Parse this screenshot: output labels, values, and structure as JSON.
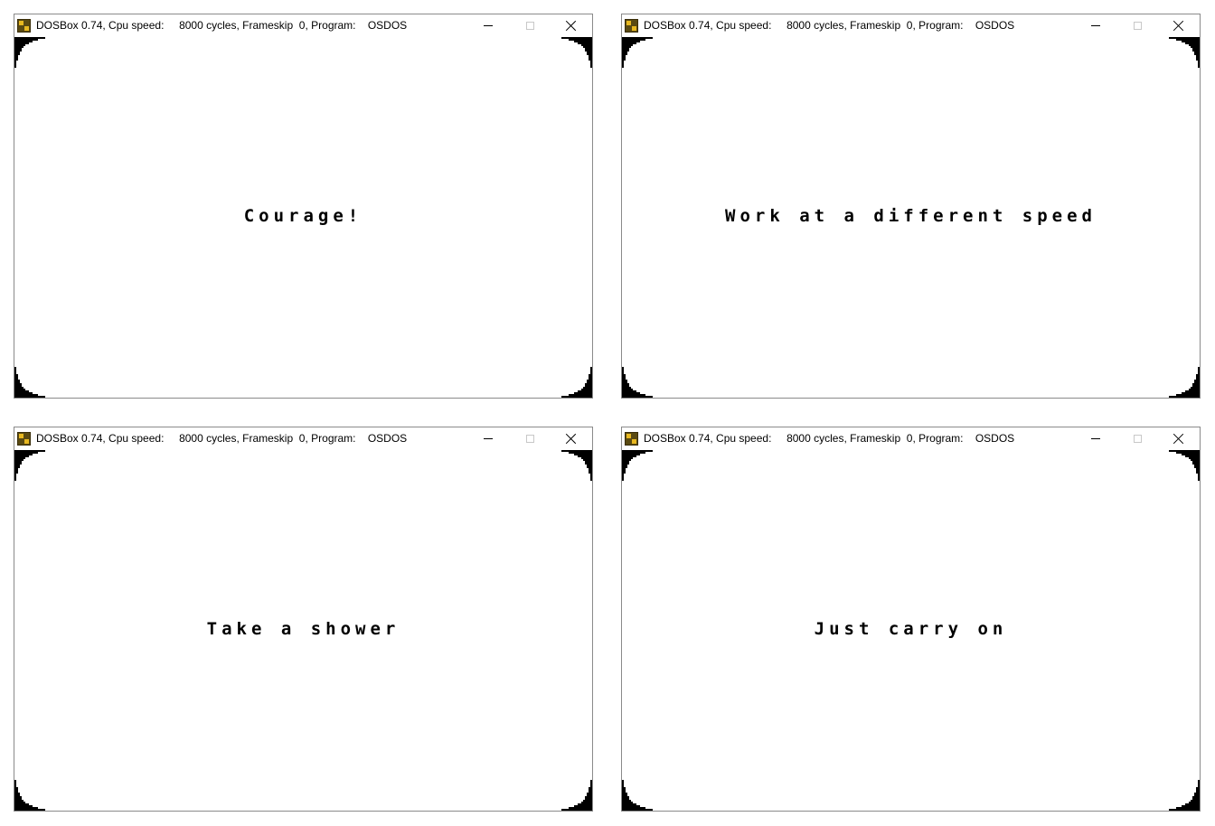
{
  "windows": [
    {
      "title": "DOSBox 0.74, Cpu speed:     8000 cycles, Frameskip  0, Program:    OSDOS",
      "message": "Courage!"
    },
    {
      "title": "DOSBox 0.74, Cpu speed:     8000 cycles, Frameskip  0, Program:    OSDOS",
      "message": "Work at a different speed"
    },
    {
      "title": "DOSBox 0.74, Cpu speed:     8000 cycles, Frameskip  0, Program:    OSDOS",
      "message": "Take a shower"
    },
    {
      "title": "DOSBox 0.74, Cpu speed:     8000 cycles, Frameskip  0, Program:    OSDOS",
      "message": "Just carry on"
    }
  ],
  "icons": {
    "app": "dosbox-icon",
    "minimize": "minimize-icon",
    "maximize": "maximize-icon",
    "close": "close-icon"
  },
  "colors": {
    "screen_background": "#ffffff",
    "text": "#000000",
    "corner_mask": "#000000"
  }
}
